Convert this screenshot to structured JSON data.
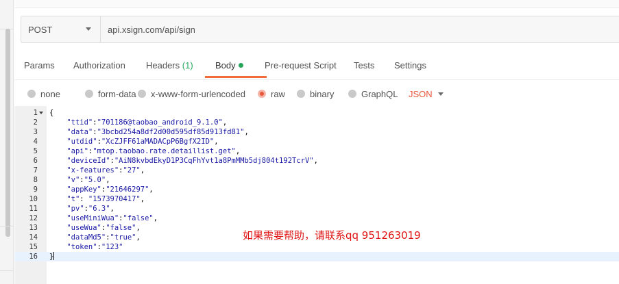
{
  "request": {
    "method": "POST",
    "url": "api.xsign.com/api/sign"
  },
  "tabs": [
    {
      "label": "Params"
    },
    {
      "label": "Authorization"
    },
    {
      "label": "Headers",
      "count": "(1)"
    },
    {
      "label": "Body",
      "active": true
    },
    {
      "label": "Pre-request Script"
    },
    {
      "label": "Tests"
    },
    {
      "label": "Settings"
    }
  ],
  "body_types": [
    {
      "label": "none"
    },
    {
      "label": "form-data"
    },
    {
      "label": "x-www-form-urlencoded"
    },
    {
      "label": "raw",
      "selected": true
    },
    {
      "label": "binary"
    },
    {
      "label": "GraphQL"
    }
  ],
  "format": "JSON",
  "accent_color": "#f26b3a",
  "status_dot_color": "#26a65b",
  "editor": {
    "lines": [
      {
        "n": "1",
        "text": "{"
      },
      {
        "n": "2",
        "key": "\"ttid\"",
        "sep": ":",
        "val": "\"701186@taobao_android_9.1.0\"",
        "tail": ","
      },
      {
        "n": "3",
        "key": "\"data\"",
        "sep": ":",
        "val": "\"3bcbd254a8df2d00d595df85d913fd81\"",
        "tail": ","
      },
      {
        "n": "4",
        "key": "\"utdid\"",
        "sep": ":",
        "val": "\"XcZJFF61aMADACpP6BgfX2ID\"",
        "tail": ","
      },
      {
        "n": "5",
        "key": "\"api\"",
        "sep": ":",
        "val": "\"mtop.taobao.rate.detaillist.get\"",
        "tail": ","
      },
      {
        "n": "6",
        "key": "\"deviceId\"",
        "sep": ":",
        "val": "\"AiN8kvbdEkyD1P3CqFhYvt1a8PmMMb5dj804t192TcrV\"",
        "tail": ","
      },
      {
        "n": "7",
        "key": "\"x-features\"",
        "sep": ":",
        "val": "\"27\"",
        "tail": ","
      },
      {
        "n": "8",
        "key": "\"v\"",
        "sep": ":",
        "val": "\"5.0\"",
        "tail": ","
      },
      {
        "n": "9",
        "key": "\"appKey\"",
        "sep": ":",
        "val": "\"21646297\"",
        "tail": ","
      },
      {
        "n": "10",
        "key": "\"t\"",
        "sep": ": ",
        "val": "\"1573970417\"",
        "tail": ","
      },
      {
        "n": "11",
        "key": "\"pv\"",
        "sep": ":",
        "val": "\"6.3\"",
        "tail": ","
      },
      {
        "n": "12",
        "key": "\"useMiniWua\"",
        "sep": ":",
        "val": "\"false\"",
        "tail": ","
      },
      {
        "n": "13",
        "key": "\"useWua\"",
        "sep": ":",
        "val": "\"false\"",
        "tail": ","
      },
      {
        "n": "14",
        "key": "\"dataMd5\"",
        "sep": ":",
        "val": "\"true\"",
        "tail": ","
      },
      {
        "n": "15",
        "key": "\"token\"",
        "sep": ":",
        "val": "\"123\"",
        "tail": ""
      },
      {
        "n": "16",
        "text": "}"
      }
    ]
  },
  "note": "如果需要帮助，请联系qq 951263019"
}
